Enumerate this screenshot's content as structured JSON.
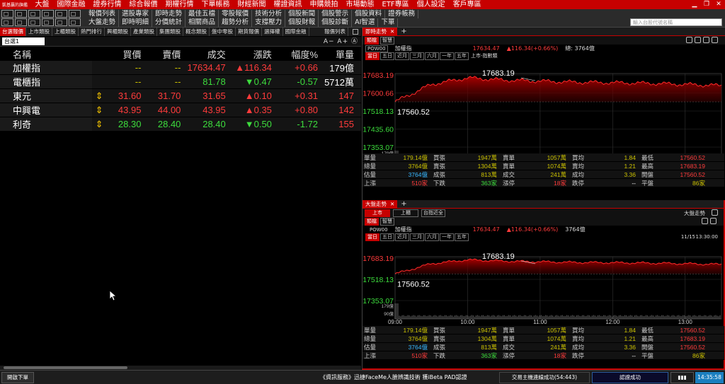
{
  "menubar": {
    "logo": "凱基贏的旗艦",
    "items": [
      "大盤",
      "國際金融",
      "證券行情",
      "綜合報價",
      "期權行情",
      "下單帳務",
      "財經新聞",
      "權證資訊",
      "申購競拍",
      "市場動態",
      "ETF專區",
      "個人設定",
      "客戶專區"
    ]
  },
  "toolbar": {
    "row1": [
      "報價列表",
      "選股專家",
      "即時走勢",
      "最佳五檔",
      "零股報價",
      "技術分析",
      "個股新聞",
      "個股警示",
      "個股資料",
      "證券帳務"
    ],
    "row2": [
      "大盤走勢",
      "即時明細",
      "分價統計",
      "相關商品",
      "趨勢分析",
      "支撐壓力",
      "個股財報",
      "個股診斷",
      "AI智選",
      "下單"
    ],
    "search_placeholder": "輸入台股代號名稱"
  },
  "left": {
    "tabs": [
      "台選報價",
      "上市類股",
      "上櫃類股",
      "熱門排行",
      "興櫃類股",
      "產業類股",
      "集團類股",
      "概念類股",
      "盤中零股",
      "期貨報價",
      "選擇權",
      "國際金融"
    ],
    "right_label": "報價列表",
    "group": "台選1",
    "font_ctrl": "A− A+ Ⓐ",
    "headers": [
      "名稱",
      "買價",
      "賣價",
      "成交",
      "漲跌",
      "幅度%",
      "單量"
    ],
    "rows": [
      {
        "name": "加權指",
        "ud": "",
        "bid": "--",
        "ask": "--",
        "last": "17634.47",
        "chg": "▲116.34",
        "pct": "+0.66",
        "vol": "179億",
        "c": [
          "yel",
          "yel",
          "red",
          "red",
          "red",
          "wht"
        ]
      },
      {
        "name": "電櫃指",
        "ud": "",
        "bid": "--",
        "ask": "--",
        "last": "81.78",
        "chg": "▼0.47",
        "pct": "-0.57",
        "vol": "5712萬",
        "c": [
          "yel",
          "yel",
          "green",
          "green",
          "green",
          "wht"
        ]
      },
      {
        "name": "東元",
        "ud": "⇕",
        "bid": "31.60",
        "ask": "31.70",
        "last": "31.65",
        "chg": "▲0.10",
        "pct": "+0.31",
        "vol": "147",
        "c": [
          "red",
          "red",
          "red",
          "red",
          "red",
          "red"
        ]
      },
      {
        "name": "中興電",
        "ud": "⇕",
        "bid": "43.95",
        "ask": "44.00",
        "last": "43.95",
        "chg": "▲0.35",
        "pct": "+0.80",
        "vol": "142",
        "c": [
          "red",
          "red",
          "red",
          "red",
          "red",
          "red"
        ]
      },
      {
        "name": "利奇",
        "ud": "⇕",
        "bid": "28.30",
        "ask": "28.40",
        "last": "28.40",
        "chg": "▼0.50",
        "pct": "-1.72",
        "vol": "155",
        "c": [
          "green",
          "green",
          "green",
          "green",
          "green",
          "red"
        ]
      }
    ]
  },
  "p1": {
    "tab": "即時走勢",
    "sub": [
      "類檔",
      "智慧"
    ],
    "code": "POW00",
    "name": "加權指",
    "price": "17634.47",
    "chg": "▲116.34(+0.66%)",
    "vol_lbl": "總: 3764億",
    "ranges": [
      "當日",
      "五日",
      "近月",
      "三月",
      "六月",
      "一年",
      "五年"
    ],
    "market": "上市-指數類",
    "yticks": [
      "17683.19",
      "17600.66",
      "17518.13",
      "17435.60",
      "17353.07"
    ],
    "high": "17683.19",
    "low": "17560.52",
    "vticks": [
      "179億",
      "119億",
      "60億"
    ],
    "xticks": [
      "09:00",
      "10:00",
      "11:00",
      "12:00",
      "13:00"
    ]
  },
  "p2": {
    "tab": "大盤走勢",
    "sub": [
      "上市",
      "上櫃",
      "台指近全"
    ],
    "title": "大盤走勢",
    "sub2": [
      "類檔",
      "智慧"
    ],
    "code": "POW00",
    "name": "加權指",
    "price": "17634.47",
    "chg": "▲116.34(+0.66%)",
    "vol_lbl": "3764億",
    "ranges": [
      "當日",
      "五日",
      "近月",
      "三月",
      "六月",
      "一年",
      "五年"
    ],
    "date": "11/15",
    "time": "13:30:00",
    "yticks": [
      "17683.19",
      "17518.13",
      "17353.07"
    ],
    "high": "17683.19",
    "low": "17560.52",
    "vticks": [
      "179億",
      "90億"
    ],
    "xticks": [
      "09:00",
      "10:00",
      "11:00",
      "12:00",
      "13:00"
    ]
  },
  "stats": [
    [
      [
        "單量",
        "179.14億",
        "yel"
      ],
      [
        "買張",
        "1947萬",
        "yel"
      ],
      [
        "賣單",
        "1057萬",
        "yel"
      ],
      [
        "買均",
        "1.84",
        "yel"
      ],
      [
        "最低",
        "17560.52",
        "red"
      ]
    ],
    [
      [
        "總量",
        "3764億",
        "yel"
      ],
      [
        "賣張",
        "1304萬",
        "yel"
      ],
      [
        "賣單",
        "1074萬",
        "yel"
      ],
      [
        "賣均",
        "1.21",
        "yel"
      ],
      [
        "最高",
        "17683.19",
        "red"
      ]
    ],
    [
      [
        "估量",
        "3764億",
        "cy"
      ],
      [
        "成張",
        "813萬",
        "yel"
      ],
      [
        "成交",
        "241萬",
        "yel"
      ],
      [
        "成均",
        "3.36",
        "yel"
      ],
      [
        "開盤",
        "17560.52",
        "red"
      ]
    ],
    [
      [
        "上漲",
        "510家",
        "red"
      ],
      [
        "下跌",
        "363家",
        "green"
      ],
      [
        "漲停",
        "18家",
        "red"
      ],
      [
        "跌停",
        "--",
        "wht"
      ],
      [
        "平盤",
        "86家",
        "yel"
      ]
    ]
  ],
  "status": {
    "left_btn": "開啟下單",
    "news": "《資訊服務》迅捷FaceMe人臉辨識技術 獲iBeta PAD認證",
    "conn": "交易主機連線成功(54:443)",
    "auth": "認證成功",
    "clock": "14:35:58"
  },
  "chart_data": [
    {
      "type": "line",
      "title": "加權指",
      "xticks": [
        "09:00",
        "10:00",
        "11:00",
        "12:00",
        "13:00"
      ],
      "ylim": [
        17353.07,
        17683.19
      ],
      "open": 17560.52,
      "high": 17683.19,
      "low": 17560.52,
      "last": 17634.47,
      "x": [
        "09:00",
        "09:30",
        "10:00",
        "10:30",
        "11:00",
        "11:30",
        "12:00",
        "12:30",
        "13:00",
        "13:30"
      ],
      "y": [
        17560.52,
        17640,
        17670,
        17660,
        17655,
        17650,
        17648,
        17645,
        17640,
        17634.47
      ]
    }
  ]
}
